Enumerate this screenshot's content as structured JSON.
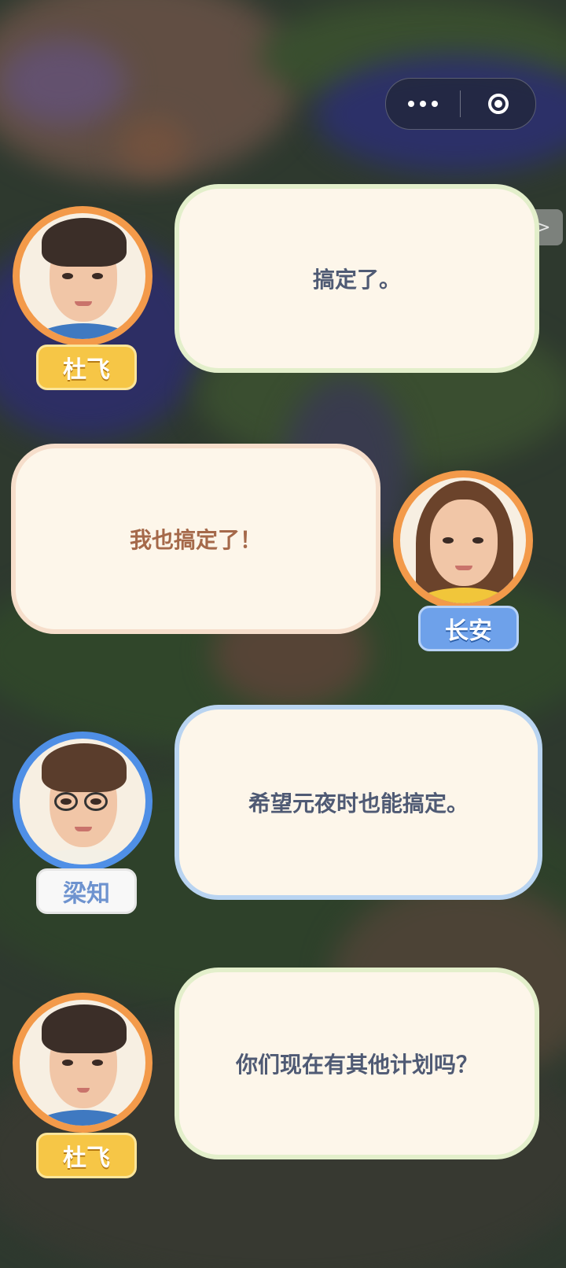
{
  "top_bar": {
    "more_icon": "more-dots-icon",
    "close_icon": "target-circle-icon",
    "skip_label": ">>"
  },
  "dialogue": [
    {
      "speaker": "杜飞",
      "text": "搞定了。",
      "side": "left",
      "ring_color": "#f39a4a",
      "tag_color": "#f6c646"
    },
    {
      "speaker": "长安",
      "text": "我也搞定了！",
      "side": "right",
      "ring_color": "#f39a4a",
      "tag_color": "#6ea1ea"
    },
    {
      "speaker": "梁知",
      "text": "希望元夜时也能搞定。",
      "side": "left",
      "ring_color": "#4f8fe6",
      "tag_color": "#f8f8f8"
    },
    {
      "speaker": "杜飞",
      "text": "你们现在有其他计划吗？",
      "side": "left",
      "ring_color": "#f39a4a",
      "tag_color": "#f6c646"
    }
  ]
}
